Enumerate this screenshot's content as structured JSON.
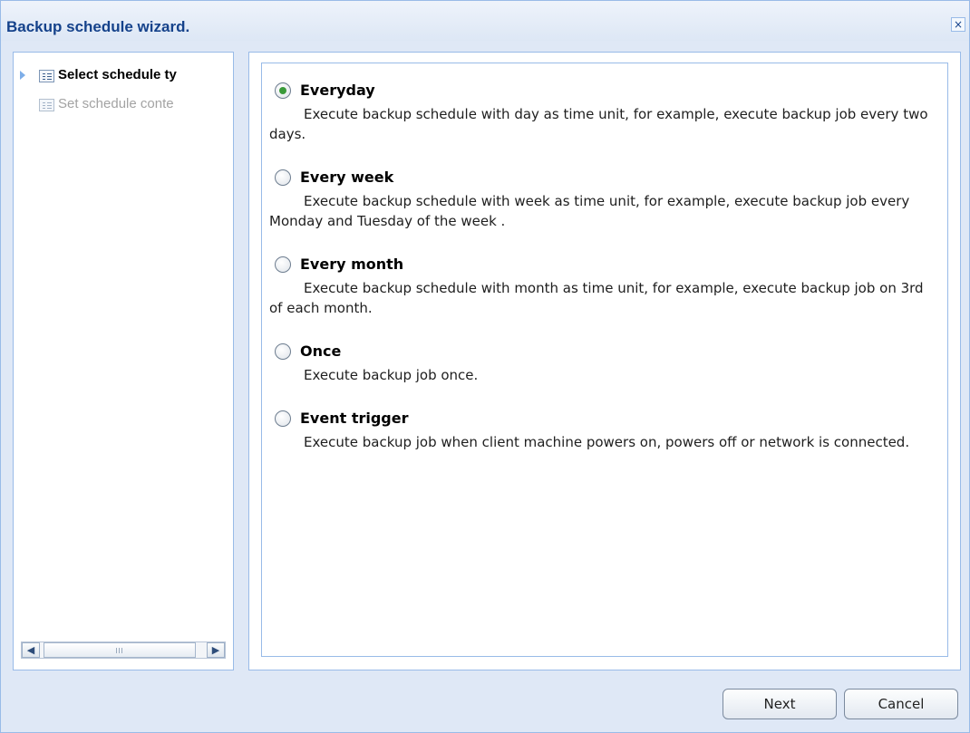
{
  "window": {
    "title": "Backup schedule wizard.",
    "close_icon": "×"
  },
  "nav": {
    "items": [
      {
        "label": "Select schedule ty",
        "active": true
      },
      {
        "label": "Set schedule conte",
        "active": false
      }
    ],
    "scrollbar": {
      "left_arrow": "◀",
      "right_arrow": "▶"
    }
  },
  "options": [
    {
      "title": "Everyday",
      "desc": "Execute backup schedule with day as time unit, for example, execute backup job every two days.",
      "checked": true
    },
    {
      "title": "Every week",
      "desc": "Execute backup schedule with week as time unit, for example, execute backup job every Monday and Tuesday of the week .",
      "checked": false
    },
    {
      "title": "Every month",
      "desc": "Execute backup schedule with month as time unit, for example, execute backup job on 3rd of each month.",
      "checked": false
    },
    {
      "title": "Once",
      "desc": "Execute backup job once.",
      "checked": false
    },
    {
      "title": "Event trigger",
      "desc": "Execute backup job when client machine powers on, powers off or network is connected.",
      "checked": false
    }
  ],
  "buttons": {
    "next": "Next",
    "cancel": "Cancel"
  },
  "colors": {
    "title": "#15428b",
    "border": "#99bbe8",
    "panel_bg": "#dfe8f6",
    "radio_checked": "#3a9a3a"
  }
}
